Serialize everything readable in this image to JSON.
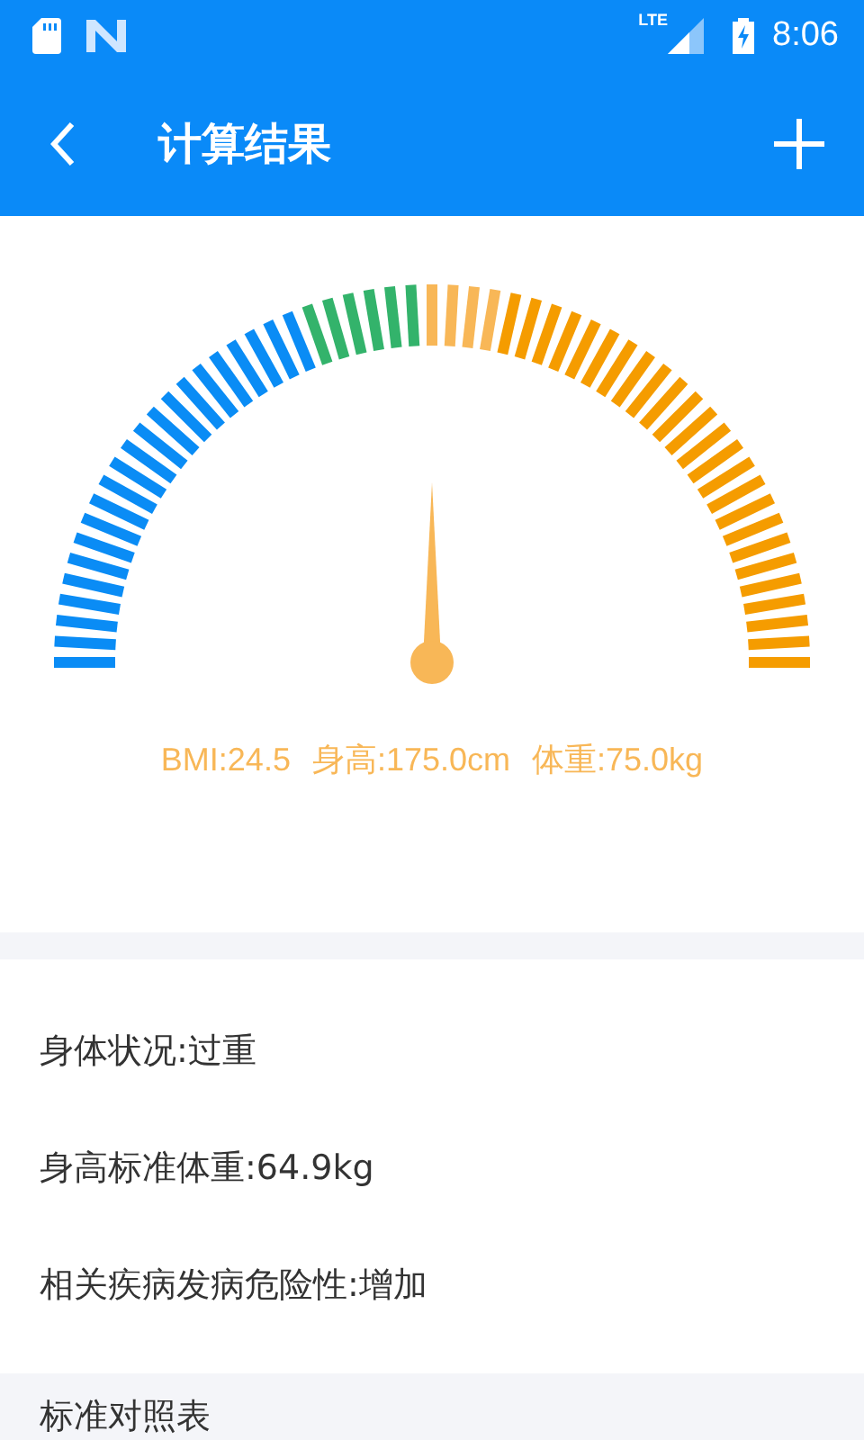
{
  "status_bar": {
    "network": "LTE",
    "time": "8:06"
  },
  "toolbar": {
    "title": "计算结果"
  },
  "readings": [
    "BMI:24.5",
    "身高:175.0cm",
    "体重:75.0kg"
  ],
  "results": [
    "身体状况:过重",
    "身高标准体重:64.9kg",
    "相关疾病发病危险性:增加"
  ],
  "section": {
    "title": "标准对照表"
  }
}
